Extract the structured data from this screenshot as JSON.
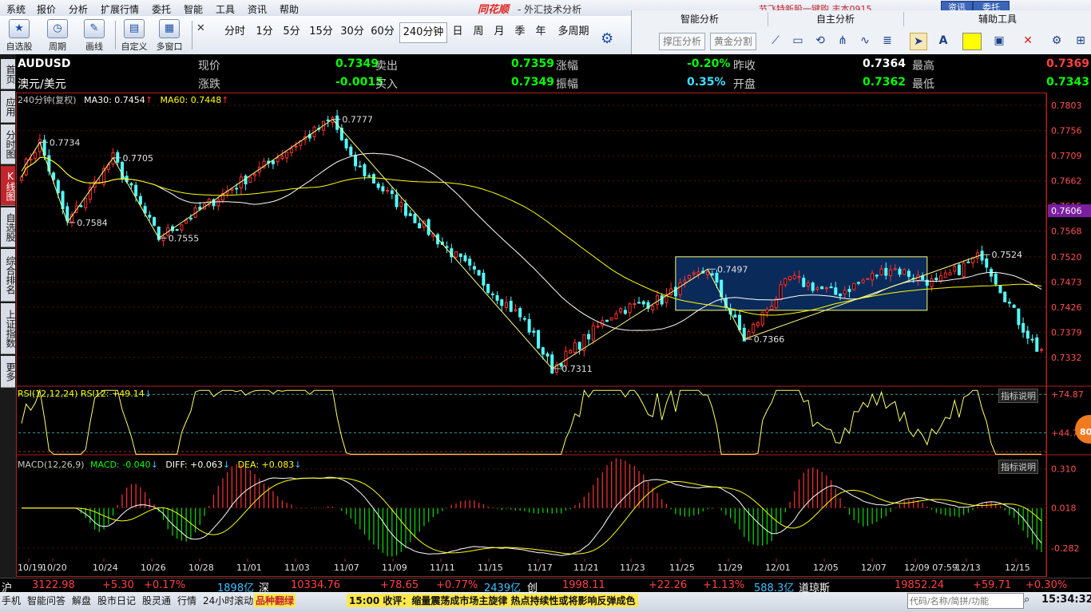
{
  "menu": {
    "items": [
      "系统",
      "报价",
      "分析",
      "扩展行情",
      "委托",
      "智能",
      "工具",
      "资讯",
      "帮助"
    ],
    "brand": "同花顺",
    "title": "- 外汇技术分析",
    "promo": "节飞特新股一键购  丰本0915"
  },
  "top_tabs": {
    "news": "资讯",
    "trade": "委托"
  },
  "toolbar": {
    "buttons": [
      {
        "label": "自选股",
        "icon": "★"
      },
      {
        "label": "周期",
        "icon": "◷"
      },
      {
        "label": "画线",
        "icon": "✎"
      },
      {
        "label": "自定义",
        "icon": "▤"
      },
      {
        "label": "多窗口",
        "icon": "▦"
      }
    ],
    "periods": [
      "分时",
      "1分",
      "5分",
      "15分",
      "30分",
      "60分",
      "240分钟",
      "日",
      "周",
      "月",
      "季",
      "年",
      "多周期"
    ],
    "active_period": "240分钟"
  },
  "right_panel": {
    "headers": [
      "智能分析",
      "自主分析",
      "辅助工具"
    ],
    "smart_buttons": [
      "撑压分析",
      "黄金分割"
    ]
  },
  "sidebar": {
    "tabs": [
      "首页",
      "应用",
      "分时图",
      "K线图",
      "自选股",
      "综合排名",
      "上证指数",
      "更多"
    ],
    "active": "K线图"
  },
  "quote": {
    "symbol": "AUDUSD",
    "name": "澳元/美元",
    "fields": [
      {
        "label": "现价",
        "value": "0.7349",
        "color": "#00ff00"
      },
      {
        "label": "卖出",
        "value": "0.7359",
        "color": "#00ff00"
      },
      {
        "label": "涨幅",
        "value": "-0.20%",
        "color": "#00ff00"
      },
      {
        "label": "昨收",
        "value": "0.7364",
        "color": "#ffffff"
      },
      {
        "label": "最高",
        "value": "0.7369",
        "color": "#ff4040"
      },
      {
        "label": "涨跌",
        "value": "-0.0015",
        "color": "#00ff00"
      },
      {
        "label": "买入",
        "value": "0.7349",
        "color": "#00ff00"
      },
      {
        "label": "振幅",
        "value": "0.35%",
        "color": "#40e0ff"
      },
      {
        "label": "开盘",
        "value": "0.7362",
        "color": "#00ff00"
      },
      {
        "label": "最低",
        "value": "0.7343",
        "color": "#00ff00"
      }
    ]
  },
  "indicators": {
    "period_label": "240分钟(复权)",
    "ma30": "MA30: 0.7454",
    "ma60": "MA60: 0.7448",
    "rsi": "RSI(12,12,24)  RSI12: +49.14",
    "macd_name": "MACD(12,26,9)",
    "macd": "MACD: -0.040",
    "diff": "DIFF: +0.063",
    "dea": "DEA: +0.083",
    "explain": "指标说明"
  },
  "chart_data": {
    "type": "candlestick",
    "price_axis": [
      "0.7803",
      "0.7756",
      "0.7709",
      "0.7662",
      "0.7615",
      "0.7568",
      "0.7520",
      "0.7473",
      "0.7426",
      "0.7379",
      "0.7332"
    ],
    "price_ylim": [
      0.7308,
      0.7815
    ],
    "current_price_tag": "0.7606",
    "rsi_axis": [
      "+74.87",
      "+44.75"
    ],
    "macd_axis": [
      "0.310",
      "0.018",
      "-0.282"
    ],
    "x_labels": [
      "10/19",
      "10/20",
      "10/24",
      "10/26",
      "10/28",
      "11/01",
      "11/03",
      "11/07",
      "11/09",
      "11/11",
      "11/15",
      "11/17",
      "11/21",
      "11/23",
      "11/25",
      "11/29",
      "12/01",
      "12/05",
      "12/07",
      "12/09 07:59",
      "12/13",
      "12/15"
    ],
    "crosshair_date": "12-09 07:59",
    "annotations": [
      "0.7734",
      "0.7705",
      "0.7777",
      "0.7584",
      "0.7555",
      "0.7311",
      "0.7497",
      "0.7366",
      "0.7524"
    ],
    "key_points": [
      {
        "t": 0,
        "p": 0.768
      },
      {
        "t": 4,
        "p": 0.7734
      },
      {
        "t": 10,
        "p": 0.7584
      },
      {
        "t": 20,
        "p": 0.7705
      },
      {
        "t": 30,
        "p": 0.7555
      },
      {
        "t": 68,
        "p": 0.7777
      },
      {
        "t": 72,
        "p": 0.77
      },
      {
        "t": 90,
        "p": 0.756
      },
      {
        "t": 110,
        "p": 0.74
      },
      {
        "t": 116,
        "p": 0.7311
      },
      {
        "t": 130,
        "p": 0.742
      },
      {
        "t": 140,
        "p": 0.744
      },
      {
        "t": 150,
        "p": 0.7497
      },
      {
        "t": 158,
        "p": 0.7366
      },
      {
        "t": 168,
        "p": 0.748
      },
      {
        "t": 178,
        "p": 0.745
      },
      {
        "t": 190,
        "p": 0.75
      },
      {
        "t": 200,
        "p": 0.747
      },
      {
        "t": 210,
        "p": 0.7524
      },
      {
        "t": 218,
        "p": 0.74
      },
      {
        "t": 222,
        "p": 0.7349
      }
    ],
    "zigzag": [
      {
        "t": 0,
        "p": 0.768
      },
      {
        "t": 4,
        "p": 0.7734
      },
      {
        "t": 10,
        "p": 0.7584
      },
      {
        "t": 20,
        "p": 0.7705
      },
      {
        "t": 30,
        "p": 0.7555
      },
      {
        "t": 68,
        "p": 0.7777
      },
      {
        "t": 116,
        "p": 0.7311
      },
      {
        "t": 150,
        "p": 0.7497
      },
      {
        "t": 158,
        "p": 0.7366
      },
      {
        "t": 210,
        "p": 0.7524
      }
    ],
    "box": {
      "t0": 143,
      "t1": 198,
      "p0": 0.752,
      "p1": 0.742
    }
  },
  "status": {
    "markets": [
      {
        "name": "沪",
        "value": "3122.98",
        "chg": "+5.30",
        "pct": "+0.17%",
        "amt": "1898亿"
      },
      {
        "name": "深",
        "value": "10334.76",
        "chg": "+78.65",
        "pct": "+0.77%",
        "amt": "2439亿"
      },
      {
        "name": "创",
        "value": "1998.11",
        "chg": "+22.26",
        "pct": "+1.13%",
        "amt": "588.3亿"
      },
      {
        "name": "道琼斯",
        "value": "19852.24",
        "chg": "+59.71",
        "pct": "+0.30%",
        "amt": ""
      }
    ],
    "bottom_buttons": [
      "手机",
      "智能问答",
      "解盘",
      "股市日记",
      "股灵通",
      "行情",
      "24小时滚动"
    ],
    "ticker_tag": "品种翻绿",
    "headline": "15:00 收评：缩量震荡成市场主旋律 热点持续性或将影响反弹成色",
    "search_placeholder": "代码/名称/简拼/功能",
    "clock": "15:34:32"
  }
}
